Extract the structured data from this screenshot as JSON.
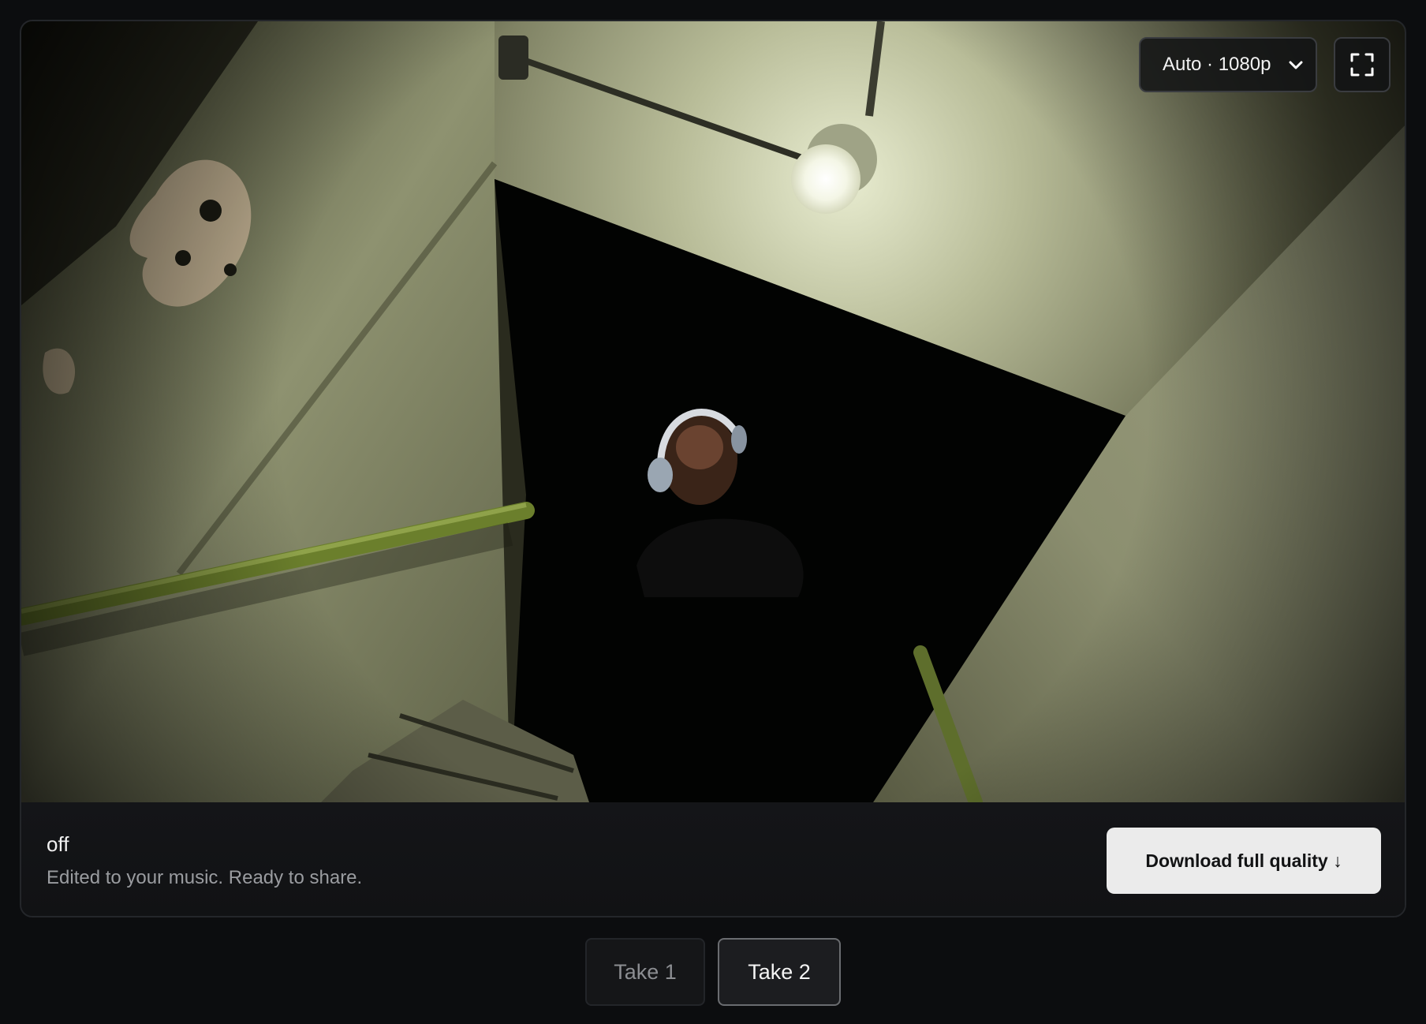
{
  "player": {
    "quality_label": "Auto · 1080p",
    "quality_icon": "chevron-down-icon",
    "fullscreen_icon": "fullscreen-icon"
  },
  "info": {
    "title": "off",
    "subtitle": "Edited to your music. Ready to share.",
    "download_label": "Download full quality ↓"
  },
  "takes": [
    {
      "label": "Take 1",
      "selected": false
    },
    {
      "label": "Take 2",
      "selected": true
    }
  ],
  "colors": {
    "background": "#0c0d0f",
    "card": "#121315",
    "button_light": "#ebebeb",
    "text_primary": "#f1f1f1",
    "text_muted": "#9a9ca0"
  }
}
